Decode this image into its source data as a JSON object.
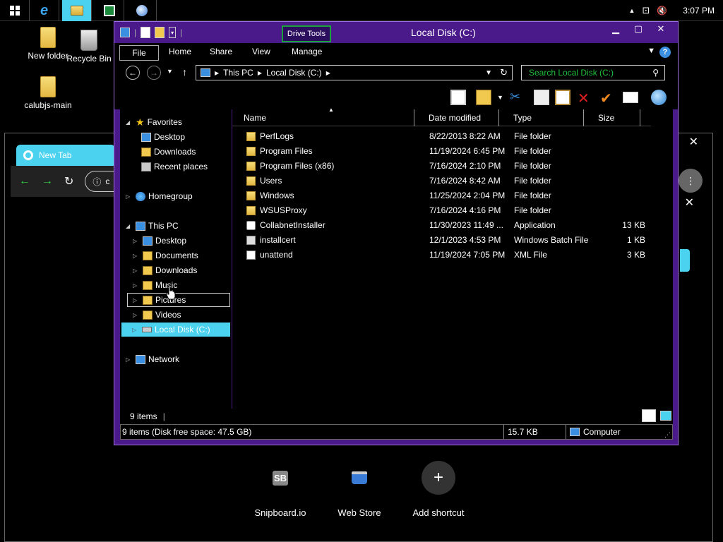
{
  "taskbar": {
    "clock": "3:07 PM"
  },
  "desktop": {
    "icons": [
      {
        "label": "New folder"
      },
      {
        "label": "Recycle Bin"
      },
      {
        "label": "calubjs-main"
      }
    ]
  },
  "browser": {
    "tab_title": "New Tab",
    "omnibox_partial": "c",
    "shortcuts": [
      {
        "label": "Snipboard.io",
        "icon_text": "SB"
      },
      {
        "label": "Web Store",
        "icon_text": ""
      },
      {
        "label": "Add shortcut",
        "icon_text": "+"
      }
    ]
  },
  "explorer": {
    "title": "Local Disk (C:)",
    "contextual_tab": "Drive Tools",
    "ribbon_tabs": [
      "File",
      "Home",
      "Share",
      "View",
      "Manage"
    ],
    "breadcrumb": [
      "This PC",
      "Local Disk (C:)"
    ],
    "search_placeholder": "Search Local Disk (C:)",
    "nav": {
      "favorites": "Favorites",
      "fav_items": [
        "Desktop",
        "Downloads",
        "Recent places"
      ],
      "homegroup": "Homegroup",
      "this_pc": "This PC",
      "pc_items": [
        "Desktop",
        "Documents",
        "Downloads",
        "Music",
        "Pictures",
        "Videos",
        "Local Disk (C:)"
      ],
      "network": "Network"
    },
    "columns": [
      "Name",
      "Date modified",
      "Type",
      "Size"
    ],
    "files": [
      {
        "name": "PerfLogs",
        "date": "8/22/2013 8:22 AM",
        "type": "File folder",
        "size": "",
        "kind": "folder"
      },
      {
        "name": "Program Files",
        "date": "11/19/2024 6:45 PM",
        "type": "File folder",
        "size": "",
        "kind": "folder"
      },
      {
        "name": "Program Files (x86)",
        "date": "7/16/2024 2:10 PM",
        "type": "File folder",
        "size": "",
        "kind": "folder"
      },
      {
        "name": "Users",
        "date": "7/16/2024 8:42 AM",
        "type": "File folder",
        "size": "",
        "kind": "folder"
      },
      {
        "name": "Windows",
        "date": "11/25/2024 2:04 PM",
        "type": "File folder",
        "size": "",
        "kind": "folder"
      },
      {
        "name": "WSUSProxy",
        "date": "7/16/2024 4:16 PM",
        "type": "File folder",
        "size": "",
        "kind": "folder"
      },
      {
        "name": "CollabnetInstaller",
        "date": "11/30/2023 11:49 ...",
        "type": "Application",
        "size": "13 KB",
        "kind": "app"
      },
      {
        "name": "installcert",
        "date": "12/1/2023 4:53 PM",
        "type": "Windows Batch File",
        "size": "1 KB",
        "kind": "bat"
      },
      {
        "name": "unattend",
        "date": "11/19/2024 7:05 PM",
        "type": "XML File",
        "size": "3 KB",
        "kind": "xml"
      }
    ],
    "item_count": "9 items",
    "status_detail": "9 items (Disk free space: 47.5 GB)",
    "status_size": "15.7 KB",
    "status_location": "Computer"
  }
}
